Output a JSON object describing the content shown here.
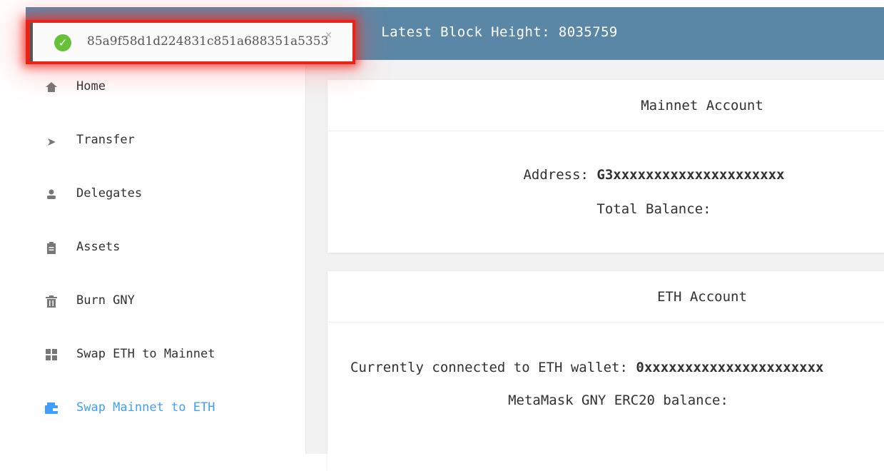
{
  "header": {
    "block_height_label": "Latest Block Height: 8035759"
  },
  "toast": {
    "hash": "85a9f58d1d224831c851a688351a5353",
    "close_glyph": "×",
    "check_glyph": "✓"
  },
  "sidebar": {
    "items": [
      {
        "label": "Home",
        "icon": "home-icon",
        "glyph": ""
      },
      {
        "label": "Transfer",
        "icon": "paper-plane-icon",
        "glyph": "➤"
      },
      {
        "label": "Delegates",
        "icon": "user-icon",
        "glyph": "👤"
      },
      {
        "label": "Assets",
        "icon": "clipboard-icon",
        "glyph": "▤"
      },
      {
        "label": "Burn GNY",
        "icon": "trash-icon",
        "glyph": "🗑"
      },
      {
        "label": "Swap ETH to Mainnet",
        "icon": "grid-icon",
        "glyph": "▦"
      },
      {
        "label": "Swap Mainnet to ETH",
        "icon": "wallet-icon",
        "glyph": "▰",
        "active": true
      }
    ]
  },
  "mainnet_card": {
    "title": "Mainnet Account",
    "address_label": "Address: ",
    "address_value": "G3xxxxxxxxxxxxxxxxxxxxx",
    "balance_label": "Total Balance:"
  },
  "eth_card": {
    "title": "ETH Account",
    "wallet_label": "Currently connected to ETH wallet: ",
    "wallet_value": "0xxxxxxxxxxxxxxxxxxxxxx",
    "erc20_label": "MetaMask GNY ERC20 balance:"
  },
  "colors": {
    "header_bg": "#5b87a6",
    "active": "#409eff",
    "success": "#67c23a",
    "highlight": "#e6241a"
  }
}
